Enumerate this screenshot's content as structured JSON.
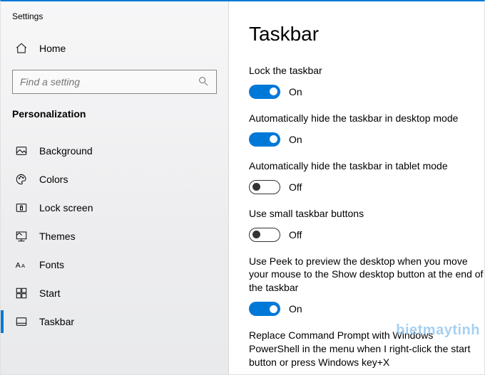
{
  "app": {
    "title": "Settings"
  },
  "sidebar": {
    "home": "Home",
    "search_placeholder": "Find a setting",
    "category": "Personalization",
    "items": [
      {
        "label": "Background"
      },
      {
        "label": "Colors"
      },
      {
        "label": "Lock screen"
      },
      {
        "label": "Themes"
      },
      {
        "label": "Fonts"
      },
      {
        "label": "Start"
      },
      {
        "label": "Taskbar"
      }
    ]
  },
  "content": {
    "heading": "Taskbar",
    "settings": [
      {
        "label": "Lock the taskbar",
        "on": true,
        "state": "On"
      },
      {
        "label": "Automatically hide the taskbar in desktop mode",
        "on": true,
        "state": "On"
      },
      {
        "label": "Automatically hide the taskbar in tablet mode",
        "on": false,
        "state": "Off"
      },
      {
        "label": "Use small taskbar buttons",
        "on": false,
        "state": "Off"
      },
      {
        "label": "Use Peek to preview the desktop when you move your mouse to the Show desktop button at the end of the taskbar",
        "on": true,
        "state": "On"
      },
      {
        "label": "Replace Command Prompt with Windows PowerShell in the menu when I right-click the start button or press Windows key+X"
      }
    ]
  },
  "watermark": "bietmaytinh"
}
